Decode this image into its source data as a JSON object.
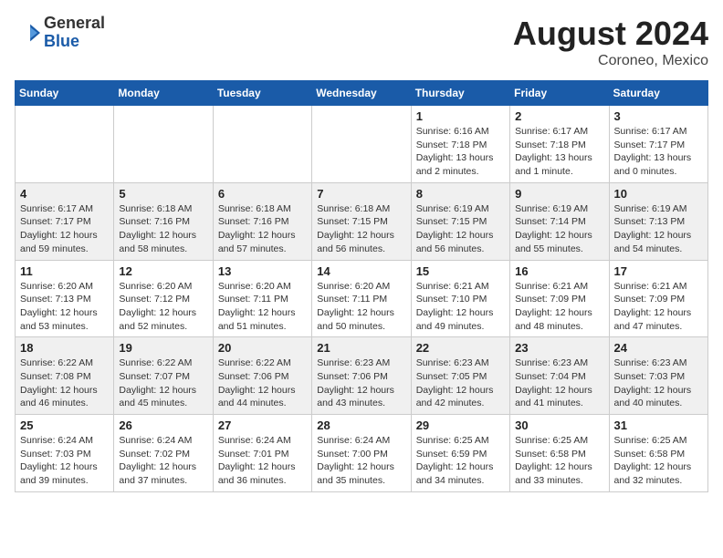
{
  "header": {
    "logo_general": "General",
    "logo_blue": "Blue",
    "month_year": "August 2024",
    "location": "Coroneo, Mexico"
  },
  "days_of_week": [
    "Sunday",
    "Monday",
    "Tuesday",
    "Wednesday",
    "Thursday",
    "Friday",
    "Saturday"
  ],
  "weeks": [
    {
      "days": [
        {
          "number": "",
          "info": ""
        },
        {
          "number": "",
          "info": ""
        },
        {
          "number": "",
          "info": ""
        },
        {
          "number": "",
          "info": ""
        },
        {
          "number": "1",
          "info": "Sunrise: 6:16 AM\nSunset: 7:18 PM\nDaylight: 13 hours\nand 2 minutes."
        },
        {
          "number": "2",
          "info": "Sunrise: 6:17 AM\nSunset: 7:18 PM\nDaylight: 13 hours\nand 1 minute."
        },
        {
          "number": "3",
          "info": "Sunrise: 6:17 AM\nSunset: 7:17 PM\nDaylight: 13 hours\nand 0 minutes."
        }
      ]
    },
    {
      "days": [
        {
          "number": "4",
          "info": "Sunrise: 6:17 AM\nSunset: 7:17 PM\nDaylight: 12 hours\nand 59 minutes."
        },
        {
          "number": "5",
          "info": "Sunrise: 6:18 AM\nSunset: 7:16 PM\nDaylight: 12 hours\nand 58 minutes."
        },
        {
          "number": "6",
          "info": "Sunrise: 6:18 AM\nSunset: 7:16 PM\nDaylight: 12 hours\nand 57 minutes."
        },
        {
          "number": "7",
          "info": "Sunrise: 6:18 AM\nSunset: 7:15 PM\nDaylight: 12 hours\nand 56 minutes."
        },
        {
          "number": "8",
          "info": "Sunrise: 6:19 AM\nSunset: 7:15 PM\nDaylight: 12 hours\nand 56 minutes."
        },
        {
          "number": "9",
          "info": "Sunrise: 6:19 AM\nSunset: 7:14 PM\nDaylight: 12 hours\nand 55 minutes."
        },
        {
          "number": "10",
          "info": "Sunrise: 6:19 AM\nSunset: 7:13 PM\nDaylight: 12 hours\nand 54 minutes."
        }
      ]
    },
    {
      "days": [
        {
          "number": "11",
          "info": "Sunrise: 6:20 AM\nSunset: 7:13 PM\nDaylight: 12 hours\nand 53 minutes."
        },
        {
          "number": "12",
          "info": "Sunrise: 6:20 AM\nSunset: 7:12 PM\nDaylight: 12 hours\nand 52 minutes."
        },
        {
          "number": "13",
          "info": "Sunrise: 6:20 AM\nSunset: 7:11 PM\nDaylight: 12 hours\nand 51 minutes."
        },
        {
          "number": "14",
          "info": "Sunrise: 6:20 AM\nSunset: 7:11 PM\nDaylight: 12 hours\nand 50 minutes."
        },
        {
          "number": "15",
          "info": "Sunrise: 6:21 AM\nSunset: 7:10 PM\nDaylight: 12 hours\nand 49 minutes."
        },
        {
          "number": "16",
          "info": "Sunrise: 6:21 AM\nSunset: 7:09 PM\nDaylight: 12 hours\nand 48 minutes."
        },
        {
          "number": "17",
          "info": "Sunrise: 6:21 AM\nSunset: 7:09 PM\nDaylight: 12 hours\nand 47 minutes."
        }
      ]
    },
    {
      "days": [
        {
          "number": "18",
          "info": "Sunrise: 6:22 AM\nSunset: 7:08 PM\nDaylight: 12 hours\nand 46 minutes."
        },
        {
          "number": "19",
          "info": "Sunrise: 6:22 AM\nSunset: 7:07 PM\nDaylight: 12 hours\nand 45 minutes."
        },
        {
          "number": "20",
          "info": "Sunrise: 6:22 AM\nSunset: 7:06 PM\nDaylight: 12 hours\nand 44 minutes."
        },
        {
          "number": "21",
          "info": "Sunrise: 6:23 AM\nSunset: 7:06 PM\nDaylight: 12 hours\nand 43 minutes."
        },
        {
          "number": "22",
          "info": "Sunrise: 6:23 AM\nSunset: 7:05 PM\nDaylight: 12 hours\nand 42 minutes."
        },
        {
          "number": "23",
          "info": "Sunrise: 6:23 AM\nSunset: 7:04 PM\nDaylight: 12 hours\nand 41 minutes."
        },
        {
          "number": "24",
          "info": "Sunrise: 6:23 AM\nSunset: 7:03 PM\nDaylight: 12 hours\nand 40 minutes."
        }
      ]
    },
    {
      "days": [
        {
          "number": "25",
          "info": "Sunrise: 6:24 AM\nSunset: 7:03 PM\nDaylight: 12 hours\nand 39 minutes."
        },
        {
          "number": "26",
          "info": "Sunrise: 6:24 AM\nSunset: 7:02 PM\nDaylight: 12 hours\nand 37 minutes."
        },
        {
          "number": "27",
          "info": "Sunrise: 6:24 AM\nSunset: 7:01 PM\nDaylight: 12 hours\nand 36 minutes."
        },
        {
          "number": "28",
          "info": "Sunrise: 6:24 AM\nSunset: 7:00 PM\nDaylight: 12 hours\nand 35 minutes."
        },
        {
          "number": "29",
          "info": "Sunrise: 6:25 AM\nSunset: 6:59 PM\nDaylight: 12 hours\nand 34 minutes."
        },
        {
          "number": "30",
          "info": "Sunrise: 6:25 AM\nSunset: 6:58 PM\nDaylight: 12 hours\nand 33 minutes."
        },
        {
          "number": "31",
          "info": "Sunrise: 6:25 AM\nSunset: 6:58 PM\nDaylight: 12 hours\nand 32 minutes."
        }
      ]
    }
  ]
}
